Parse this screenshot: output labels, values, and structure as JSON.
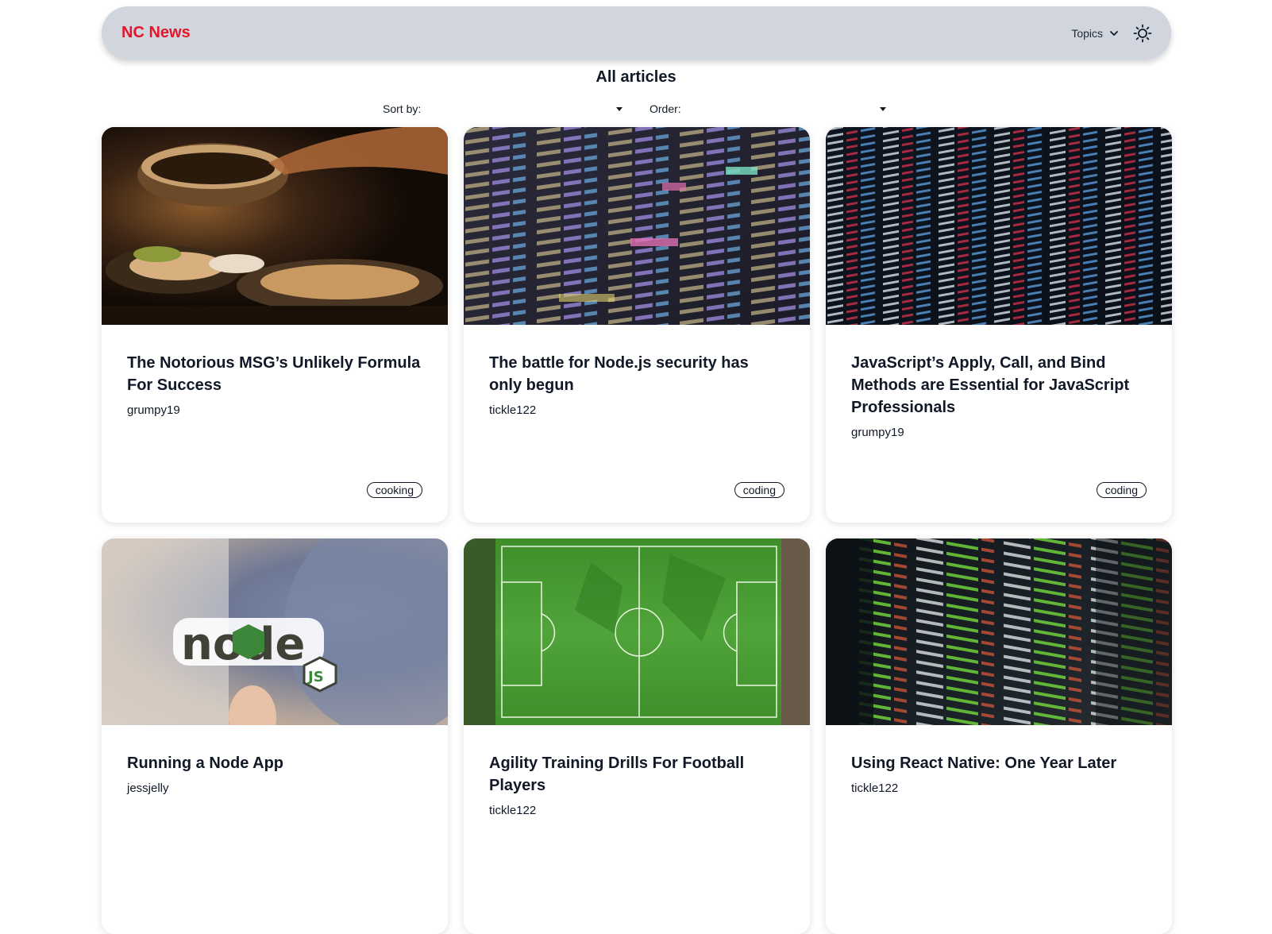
{
  "navbar": {
    "brand": "NC News",
    "topics_label": "Topics",
    "topics_icon": "chevron-down-icon",
    "theme_icon": "sun-icon",
    "brand_color": "#e4162b"
  },
  "page": {
    "title": "All articles"
  },
  "filters": {
    "sort_label": "Sort by:",
    "sort_value": "",
    "order_label": "Order:",
    "order_value": ""
  },
  "articles": [
    {
      "title": "The Notorious MSG’s Unlikely Formula For Success",
      "author": "grumpy19",
      "topic": "cooking",
      "image": "cooking-photo"
    },
    {
      "title": "The battle for Node.js security has only begun",
      "author": "tickle122",
      "topic": "coding",
      "image": "code-screen-photo"
    },
    {
      "title": "JavaScript’s Apply, Call, and Bind Methods are Essential for JavaScript Professionals",
      "author": "grumpy19",
      "topic": "coding",
      "image": "code-screen-photo"
    },
    {
      "title": "Running a Node App",
      "author": "jessjelly",
      "topic": "",
      "image": "node-sticker-photo"
    },
    {
      "title": "Agility Training Drills For Football Players",
      "author": "tickle122",
      "topic": "",
      "image": "football-pitch-photo"
    },
    {
      "title": "Using React Native: One Year Later",
      "author": "tickle122",
      "topic": "",
      "image": "code-screen-photo"
    }
  ]
}
